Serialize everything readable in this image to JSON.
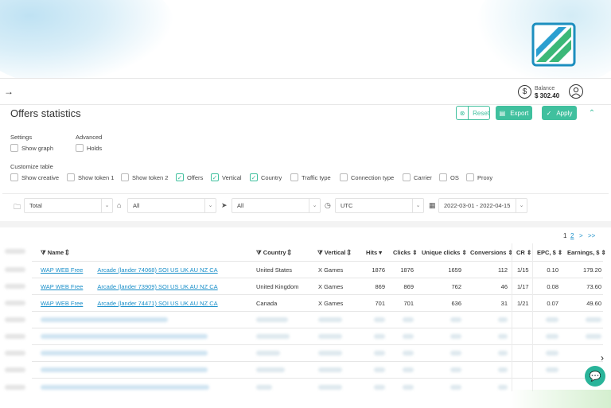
{
  "header": {
    "balance_label": "Balance",
    "balance_value": "$ 302.40"
  },
  "page": {
    "title": "Offers statistics",
    "reset": "Reset",
    "export": "Export",
    "apply": "Apply"
  },
  "settings": {
    "label": "Settings",
    "show_graph": "Show graph",
    "advanced_label": "Advanced",
    "holds": "Holds"
  },
  "customize": {
    "label": "Customize table",
    "items": [
      {
        "label": "Show creative",
        "checked": false
      },
      {
        "label": "Show token 1",
        "checked": false
      },
      {
        "label": "Show token 2",
        "checked": false
      },
      {
        "label": "Offers",
        "checked": true
      },
      {
        "label": "Vertical",
        "checked": true
      },
      {
        "label": "Country",
        "checked": true
      },
      {
        "label": "Traffic type",
        "checked": false
      },
      {
        "label": "Connection type",
        "checked": false
      },
      {
        "label": "Carrier",
        "checked": false
      },
      {
        "label": "OS",
        "checked": false
      },
      {
        "label": "Proxy",
        "checked": false
      }
    ]
  },
  "filters": {
    "offer": "Total",
    "tag": "All",
    "source": "All",
    "timezone": "UTC",
    "date_range": "2022-03-01 - 2022-04-15"
  },
  "pager": {
    "p1": "1",
    "p2": "2",
    "next": ">",
    "last": ">>"
  },
  "table": {
    "headers": {
      "name": "Name",
      "country": "Country",
      "vertical": "Vertical",
      "hits": "Hits",
      "clicks": "Clicks",
      "unique": "Unique clicks",
      "conversions": "Conversions",
      "cr": "CR",
      "epc": "EPC, $",
      "earnings": "Earnings, $"
    },
    "rows": [
      {
        "name_a": "WAP WEB Free",
        "name_b": "Arcade (lander 74068) SOI US UK AU NZ CA",
        "country": "United States",
        "vertical": "X Games",
        "hits": "1876",
        "clicks": "1876",
        "unique": "1659",
        "conversions": "112",
        "cr": "1/15",
        "epc": "0.10",
        "earnings": "179.20"
      },
      {
        "name_a": "WAP WEB Free",
        "name_b": "Arcade (lander 73909) SOI US UK AU NZ CA",
        "country": "United Kingdom",
        "vertical": "X Games",
        "hits": "869",
        "clicks": "869",
        "unique": "762",
        "conversions": "46",
        "cr": "1/17",
        "epc": "0.08",
        "earnings": "73.60"
      },
      {
        "name_a": "WAP WEB Free",
        "name_b": "Arcade (lander 74471) SOI US UK AU NZ CA",
        "country": "Canada",
        "vertical": "X Games",
        "hits": "701",
        "clicks": "701",
        "unique": "636",
        "conversions": "31",
        "cr": "1/21",
        "epc": "0.07",
        "earnings": "49.60"
      }
    ]
  }
}
